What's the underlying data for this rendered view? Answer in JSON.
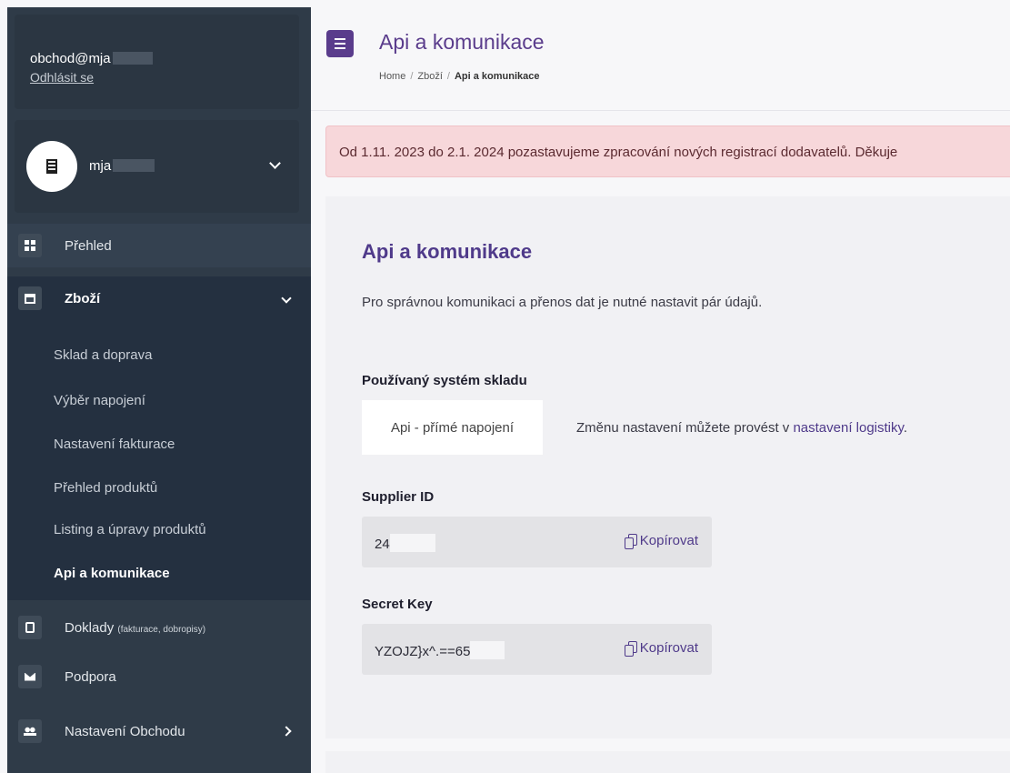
{
  "user": {
    "email": "obchod@mja",
    "logout_label": "Odhlásit se"
  },
  "shop": {
    "name": "mja"
  },
  "nav": {
    "prehled": "Přehled",
    "zbozi": "Zboží",
    "sub": [
      "Sklad a doprava",
      "Výběr napojení",
      "Nastavení fakturace",
      "Přehled produktů",
      "Listing a úpravy produktů",
      "Api a komunikace"
    ],
    "doklady": "Doklady",
    "doklady_note": "(fakturace, dobropisy)",
    "podpora": "Podpora",
    "nastaveni": "Nastavení Obchodu"
  },
  "header": {
    "title": "Api a komunikace",
    "breadcrumb": [
      "Home",
      "Zboží",
      "Api a komunikace"
    ]
  },
  "alert": {
    "text": "Od 1.11. 2023 do 2.1. 2024 pozastavujeme zpracování nových registrací dodavatelů. Děkuje"
  },
  "content": {
    "title": "Api a komunikace",
    "description": "Pro správnou komunikaci a přenos dat je nutné nastavit pár údajů.",
    "system_label": "Používaný systém skladu",
    "system_value": "Api - přímé napojení",
    "system_note": "Změnu nastavení můžete provést v ",
    "system_note_link": "nastavení logistiky",
    "system_note_end": ".",
    "supplier_label": "Supplier ID",
    "supplier_value": "24",
    "secret_label": "Secret Key",
    "secret_value": "YZOJZ}x^.==65",
    "copy_label": "Kopírovat"
  },
  "colors": {
    "accent": "#5a3c8c",
    "sidebar": "#2f3b48",
    "alert_bg": "#f7d7da"
  }
}
